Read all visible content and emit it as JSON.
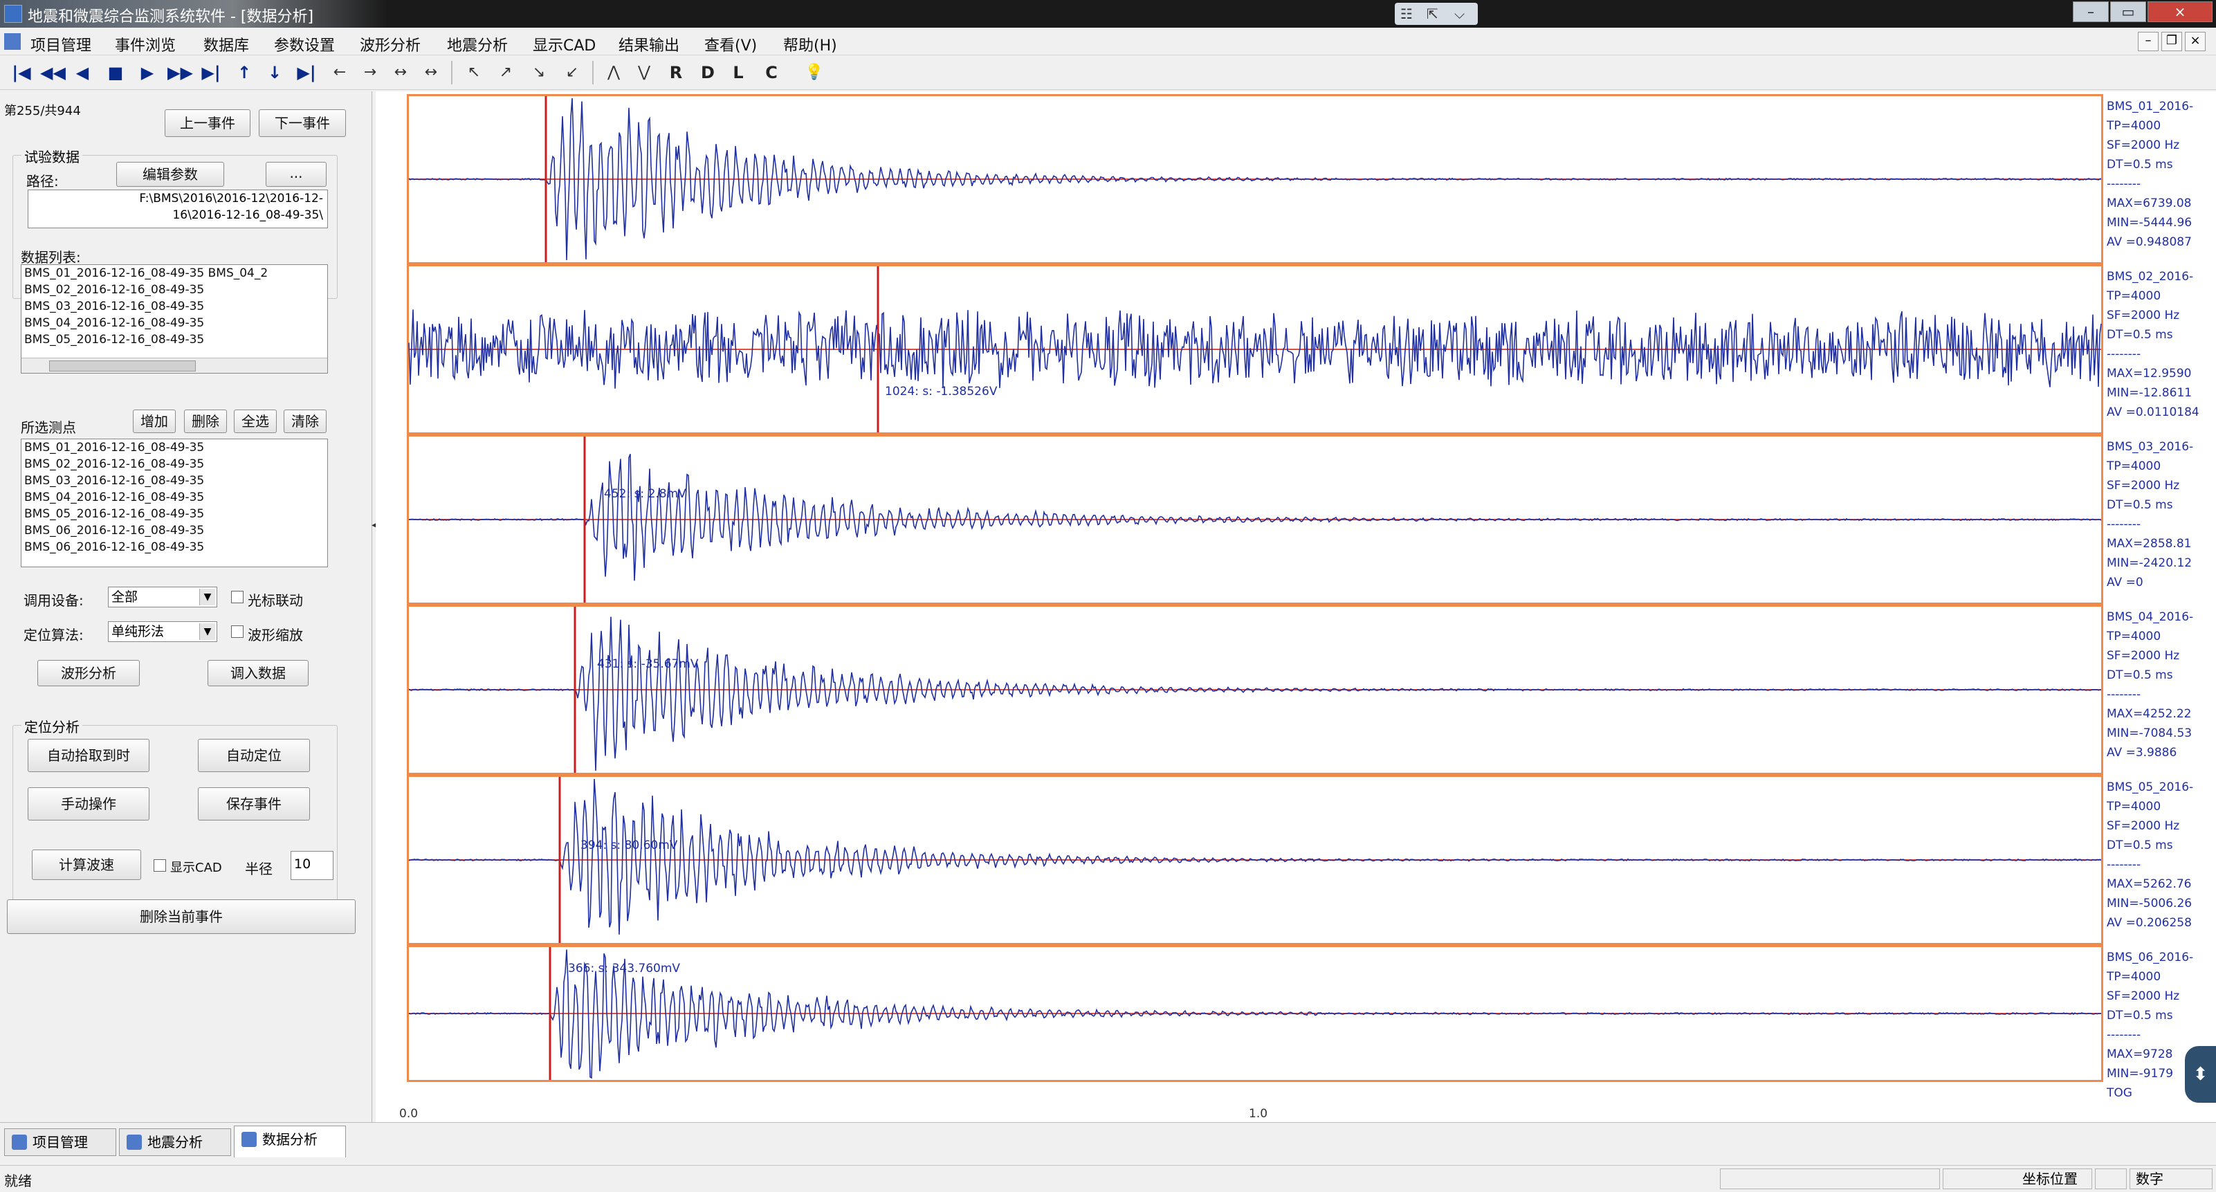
{
  "window": {
    "title": "地震和微震综合监测系统软件 - [数据分析]",
    "mid_buttons": [
      "☷",
      "⇱",
      "⌵"
    ],
    "controls": [
      "–",
      "▭",
      "×"
    ]
  },
  "menu": {
    "items": [
      "项目管理",
      "事件浏览",
      "数据库",
      "参数设置",
      "波形分析",
      "地震分析",
      "显示CAD",
      "结果输出",
      "查看(V)",
      "帮助(H)"
    ],
    "mdi_controls": [
      "–",
      "❐",
      "×"
    ]
  },
  "toolbar": {
    "buttons": [
      "|◀",
      "◀◀",
      "◀",
      "■",
      "▶",
      "▶▶",
      "▶|",
      "↑",
      "↓",
      "▶|",
      "←",
      "→",
      "↔",
      "↔",
      "↖",
      "↗",
      "↘",
      "↙",
      "⋀",
      "⋁",
      "R",
      "D",
      "L",
      "C",
      "💡"
    ]
  },
  "left": {
    "event_counter": "第255/共944",
    "prev_event": "上一事件",
    "next_event": "下一事件",
    "test_group_title": "试验数据",
    "path_label": "路径:",
    "edit_params": "编辑参数",
    "ellipsis": "...",
    "path_lines": [
      "F:\\BMS\\2016\\2016-12\\2016-12-",
      "16\\2016-12-16_08-49-35\\"
    ],
    "data_list_label": "数据列表:",
    "data_list": [
      "BMS_01_2016-12-16_08-49-35   BMS_04_2",
      "BMS_02_2016-12-16_08-49-35",
      "BMS_03_2016-12-16_08-49-35",
      "BMS_04_2016-12-16_08-49-35",
      "BMS_05_2016-12-16_08-49-35"
    ],
    "selected_label": "所选测点",
    "add_btn": "增加",
    "delete_btn": "删除",
    "select_all_btn": "全选",
    "clear_btn": "清除",
    "selected_list": [
      "BMS_01_2016-12-16_08-49-35",
      "BMS_02_2016-12-16_08-49-35",
      "BMS_03_2016-12-16_08-49-35",
      "BMS_04_2016-12-16_08-49-35",
      "BMS_05_2016-12-16_08-49-35",
      "BMS_06_2016-12-16_08-49-35",
      "BMS_06_2016-12-16_08-49-35"
    ],
    "pick_setting_label": "调用设备:",
    "pick_setting_value": "全部",
    "cad_link_label": "光标联动",
    "locate_algo_label": "定位算法:",
    "locate_algo_value": "单纯形法",
    "waveform_label": "波形缩放",
    "wave_analysis_btn": "波形分析",
    "import_data_btn": "调入数据",
    "locate_group_title": "定位分析",
    "auto_pick_btn": "自动拾取到时",
    "auto_locate_btn": "自动定位",
    "manual_op_btn": "手动操作",
    "save_event_btn": "保存事件",
    "calc_velocity_btn": "计算波速",
    "show_cad_label": "显示CAD",
    "radius_label": "半径",
    "radius_value": "10",
    "delete_event_btn": "删除当前事件"
  },
  "channels": [
    {
      "info": [
        "BMS_01_2016-",
        "TP=4000",
        "SF=2000 Hz",
        "DT=0.5 ms",
        "--------",
        "MAX=6739.08",
        "MIN=-5444.96",
        "AV =0.948087"
      ],
      "pick_label": ""
    },
    {
      "info": [
        "BMS_02_2016-",
        "TP=4000",
        "SF=2000 Hz",
        "DT=0.5 ms",
        "--------",
        "MAX=12.9590",
        "MIN=-12.8611",
        "AV =0.0110184"
      ],
      "pick_label": "1024: s: -1.38526V"
    },
    {
      "info": [
        "BMS_03_2016-",
        "TP=4000",
        "SF=2000 Hz",
        "DT=0.5 ms",
        "--------",
        "MAX=2858.81",
        "MIN=-2420.12",
        "AV =0"
      ],
      "pick_label": "452: s: 2.8mV"
    },
    {
      "info": [
        "BMS_04_2016-",
        "TP=4000",
        "SF=2000 Hz",
        "DT=0.5 ms",
        "--------",
        "MAX=4252.22",
        "MIN=-7084.53",
        "AV =3.9886"
      ],
      "pick_label": "431: s: -35.67mV"
    },
    {
      "info": [
        "BMS_05_2016-",
        "TP=4000",
        "SF=2000 Hz",
        "DT=0.5 ms",
        "--------",
        "MAX=5262.76",
        "MIN=-5006.26",
        "AV =0.206258"
      ],
      "pick_label": "394: s: 80.60mV"
    },
    {
      "info": [
        "BMS_06_2016-",
        "TP=4000",
        "SF=2000 Hz",
        "DT=0.5 ms",
        "--------",
        "MAX=9728",
        "MIN=-9179",
        "TOG"
      ],
      "pick_label": "366: s: 343.760mV"
    }
  ],
  "x_ticks": [
    "0.0",
    "1.0"
  ],
  "tabs": [
    "项目管理",
    "地震分析",
    "数据分析"
  ],
  "status": {
    "left": "就绪",
    "cells": [
      "",
      "坐标位置",
      "",
      "数字"
    ]
  },
  "badge": "⬍",
  "colors": {
    "border": "#f08a4b",
    "wave": "#2030a0",
    "baseline": "#e05040",
    "pick": "#c81e1e"
  }
}
